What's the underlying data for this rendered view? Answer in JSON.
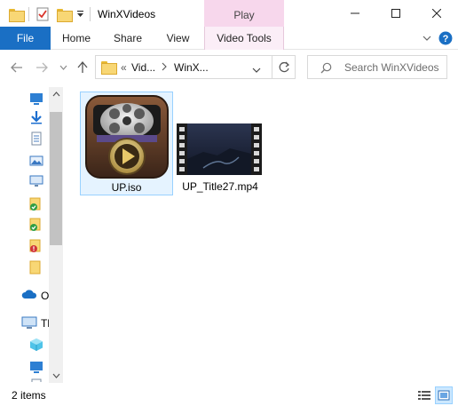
{
  "window": {
    "title": "WinXVideos",
    "contextual_tab": "Play",
    "accent_color": "#1a6fc4",
    "contextual_color": "#f7d7ec"
  },
  "ribbon": {
    "tabs": [
      "File",
      "Home",
      "Share",
      "View",
      "Video Tools"
    ]
  },
  "address": {
    "overflow": "«",
    "segments": [
      "Vid...",
      "WinX..."
    ],
    "search_placeholder": "Search WinXVideos"
  },
  "nav": {
    "partial_labels": [
      "O",
      "Th"
    ]
  },
  "files": [
    {
      "name": "UP.iso",
      "icon": "media-player-icon",
      "selected": true
    },
    {
      "name": "UP_Title27.mp4",
      "icon": "video-thumbnail-icon",
      "selected": false
    }
  ],
  "status": {
    "count_text": "2 items"
  }
}
